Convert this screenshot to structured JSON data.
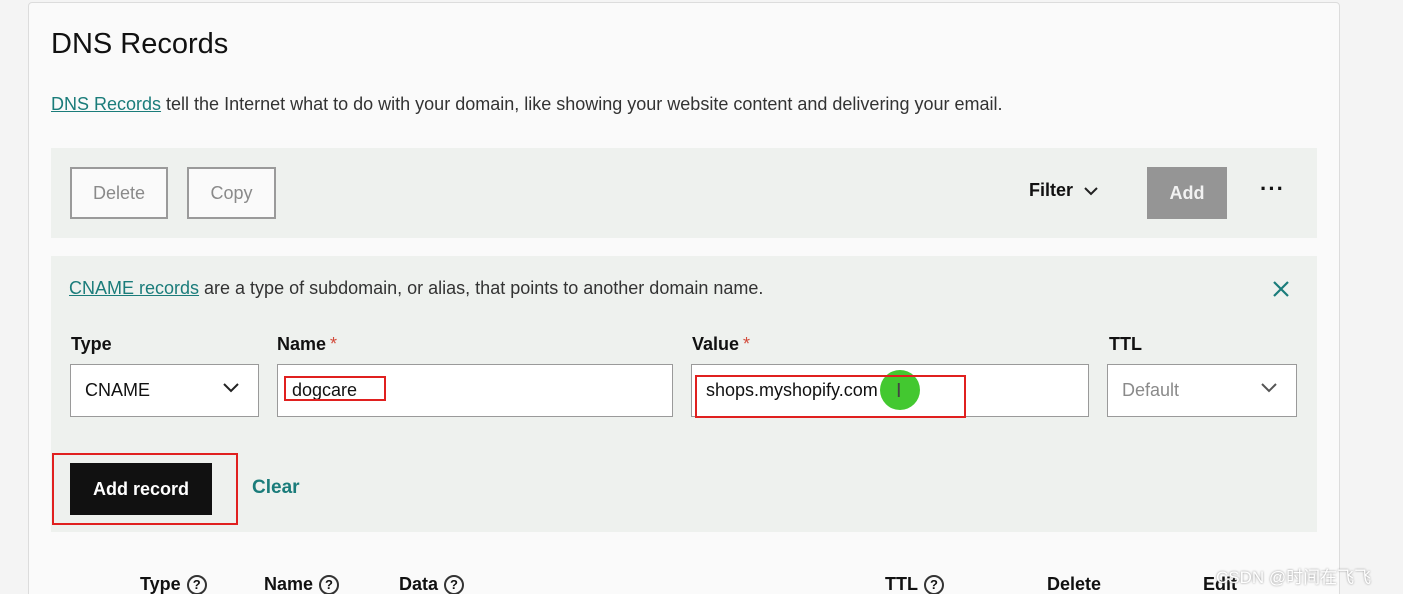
{
  "page": {
    "title": "DNS Records",
    "intro_link": "DNS Records",
    "intro_text": " tell the Internet what to do with your domain, like showing your website content and delivering your email."
  },
  "toolbar": {
    "delete_label": "Delete",
    "copy_label": "Copy",
    "filter_label": "Filter",
    "add_label": "Add",
    "more_label": "···"
  },
  "form": {
    "note_link": "CNAME records",
    "note_text": " are a type of subdomain, or alias, that points to another domain name.",
    "type_label": "Type",
    "type_value": "CNAME",
    "name_label": "Name",
    "name_value": "dogcare",
    "value_label": "Value",
    "value_value": "shops.myshopify.com",
    "ttl_label": "TTL",
    "ttl_value": "Default",
    "required_marker": "*",
    "add_record_label": "Add record",
    "clear_label": "Clear"
  },
  "table": {
    "headers": [
      "Type",
      "Name",
      "Data",
      "TTL",
      "Delete",
      "Edit"
    ],
    "help_marker": "?"
  },
  "watermark": "CSDN @时间在飞飞",
  "colors": {
    "accent": "#1a7c7a",
    "highlight": "#e0201f",
    "primary_button": "#111111",
    "disabled_button": "#959595"
  }
}
